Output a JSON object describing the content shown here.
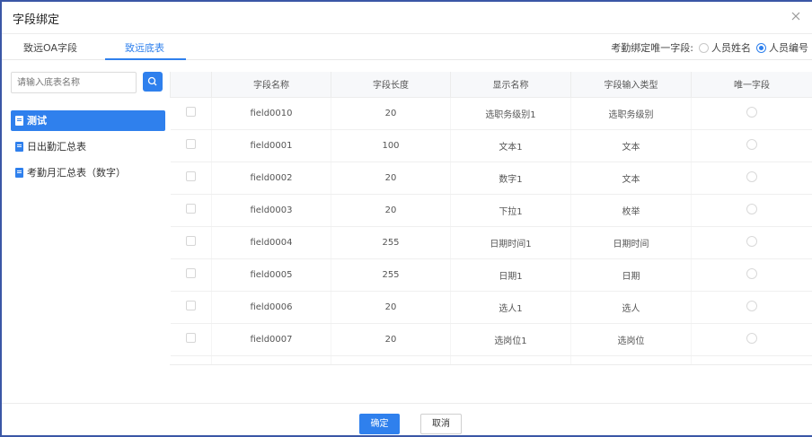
{
  "dialog": {
    "title": "字段绑定",
    "close_icon": "close-icon"
  },
  "tabs": [
    {
      "label": "致远OA字段",
      "active": false
    },
    {
      "label": "致远底表",
      "active": true
    }
  ],
  "unique_field": {
    "label": "考勤绑定唯一字段:",
    "options": [
      {
        "label": "人员姓名",
        "checked": false
      },
      {
        "label": "人员编号",
        "checked": true
      }
    ]
  },
  "search": {
    "placeholder": "请输入底表名称",
    "icon": "search-icon"
  },
  "tree": [
    {
      "label": "测试",
      "active": true
    },
    {
      "label": "日出勤汇总表",
      "active": false
    },
    {
      "label": "考勤月汇总表（数字）",
      "active": false
    }
  ],
  "table": {
    "columns": [
      "字段名称",
      "字段长度",
      "显示名称",
      "字段输入类型",
      "唯一字段"
    ],
    "rows": [
      {
        "name": "field0010",
        "length": "20",
        "display": "选职务级别1",
        "type": "选职务级别"
      },
      {
        "name": "field0001",
        "length": "100",
        "display": "文本1",
        "type": "文本"
      },
      {
        "name": "field0002",
        "length": "20",
        "display": "数字1",
        "type": "文本"
      },
      {
        "name": "field0003",
        "length": "20",
        "display": "下拉1",
        "type": "枚举"
      },
      {
        "name": "field0004",
        "length": "255",
        "display": "日期时间1",
        "type": "日期时间"
      },
      {
        "name": "field0005",
        "length": "255",
        "display": "日期1",
        "type": "日期"
      },
      {
        "name": "field0006",
        "length": "20",
        "display": "选人1",
        "type": "选人"
      },
      {
        "name": "field0007",
        "length": "20",
        "display": "选岗位1",
        "type": "选岗位"
      }
    ]
  },
  "footer": {
    "ok_label": "确定",
    "cancel_label": "取消"
  },
  "colors": {
    "accent": "#2f80ed",
    "border": "#3a57a6"
  }
}
